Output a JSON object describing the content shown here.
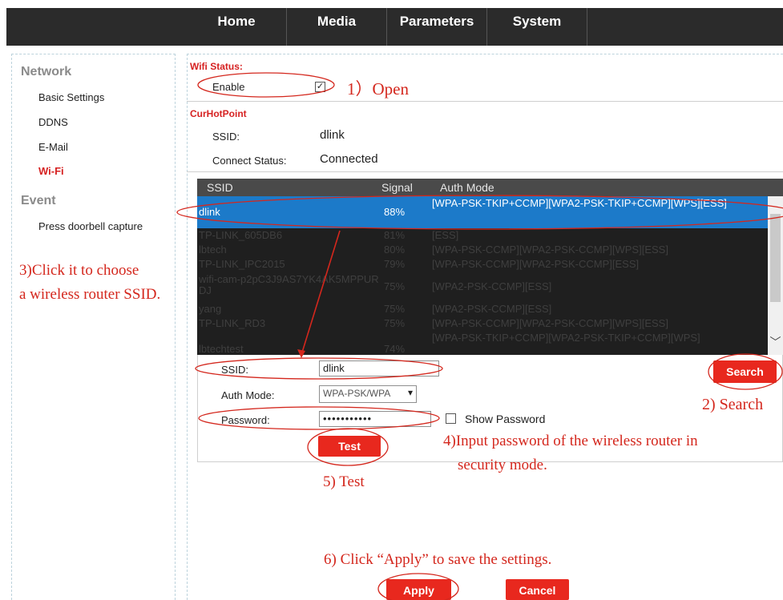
{
  "nav": {
    "items": [
      "Home",
      "Media",
      "Parameters",
      "System"
    ]
  },
  "sidebar": {
    "network_title": "Network",
    "network_items": [
      "Basic Settings",
      "DDNS",
      "E-Mail",
      "Wi-Fi"
    ],
    "event_title": "Event",
    "event_items": [
      "Press doorbell capture"
    ]
  },
  "wifi_status": {
    "heading": "Wifi Status:",
    "enable_label": "Enable",
    "enable_checked": true
  },
  "cur_hotpoint": {
    "heading": "CurHotPoint",
    "ssid_label": "SSID:",
    "ssid_value": "dlink",
    "status_label": "Connect Status:",
    "status_value": "Connected"
  },
  "table": {
    "headers": [
      "SSID",
      "Signal",
      "Auth Mode"
    ],
    "rows": [
      {
        "ssid": "dlink",
        "signal": "88%",
        "auth": "[WPA-PSK-TKIP+CCMP][WPA2-PSK-TKIP+CCMP][WPS][ESS]",
        "selected": true
      },
      {
        "ssid": "TP-LINK_605DB6",
        "signal": "81%",
        "auth": "[ESS]"
      },
      {
        "ssid": "lbtech",
        "signal": "80%",
        "auth": "[WPA-PSK-CCMP][WPA2-PSK-CCMP][WPS][ESS]"
      },
      {
        "ssid": "TP-LINK_IPC2015",
        "signal": "79%",
        "auth": "[WPA-PSK-CCMP][WPA2-PSK-CCMP][ESS]"
      },
      {
        "ssid": "wifi-cam-p2pC3J9AS7YK4AK5MPPURDJ",
        "signal": "75%",
        "auth": "[WPA2-PSK-CCMP][ESS]"
      },
      {
        "ssid": "yang",
        "signal": "75%",
        "auth": "[WPA2-PSK-CCMP][ESS]"
      },
      {
        "ssid": "TP-LINK_RD3",
        "signal": "75%",
        "auth": "[WPA-PSK-CCMP][WPA2-PSK-CCMP][WPS][ESS]"
      },
      {
        "ssid": "lbtechtest",
        "signal": "74%",
        "auth": "[WPA-PSK-TKIP+CCMP][WPA2-PSK-TKIP+CCMP][WPS]"
      }
    ]
  },
  "form": {
    "ssid_label": "SSID:",
    "ssid_value": "dlink",
    "auth_label": "Auth Mode:",
    "auth_value": "WPA-PSK/WPA",
    "password_label": "Password:",
    "password_value": "•••••••••••",
    "show_password_label": "Show Password",
    "show_password_checked": false,
    "search_label": "Search",
    "test_label": "Test"
  },
  "buttons": {
    "apply": "Apply",
    "cancel": "Cancel"
  },
  "annotations": {
    "open": "1）Open",
    "search": "2) Search",
    "choose_line1": "3)Click it to choose",
    "choose_line2": "a wireless router SSID.",
    "password_line1": "4)Input password of the wireless router in",
    "password_line2": "security mode.",
    "test": "5) Test",
    "apply": "6) Click “Apply” to save the settings."
  },
  "colors": {
    "accent": "#e8281e",
    "annotation": "#d4271d",
    "selected_row": "#1c7ac9",
    "nav_bg": "#2b2b2b"
  }
}
